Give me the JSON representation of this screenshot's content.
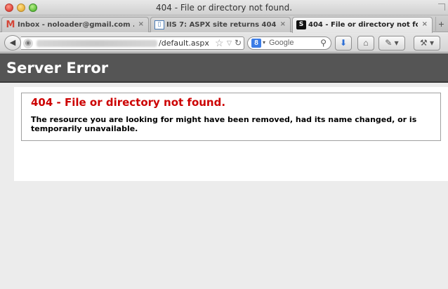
{
  "window": {
    "title": "404 - File or directory not found."
  },
  "tabs": [
    {
      "label": "Inbox - noloader@gmail.com ...",
      "icon": "gmail-icon",
      "active": false
    },
    {
      "label": "IIS 7: ASPX site returns 404 (...",
      "icon": "document-icon",
      "active": false
    },
    {
      "label": "404 - File or directory not fo...",
      "icon": "stackoverflow-icon",
      "active": true
    }
  ],
  "tab_close_glyph": "×",
  "new_tab_glyph": "+",
  "navbar": {
    "url_path": "/default.aspx",
    "search_placeholder": "Google"
  },
  "page": {
    "header_title": "Server Error",
    "error_heading": "404 - File or directory not found.",
    "error_message": "The resource you are looking for might have been removed, had its name changed, or is temporarily unavailable."
  },
  "colors": {
    "header_bg": "#555555",
    "error_red": "#cc0000"
  }
}
